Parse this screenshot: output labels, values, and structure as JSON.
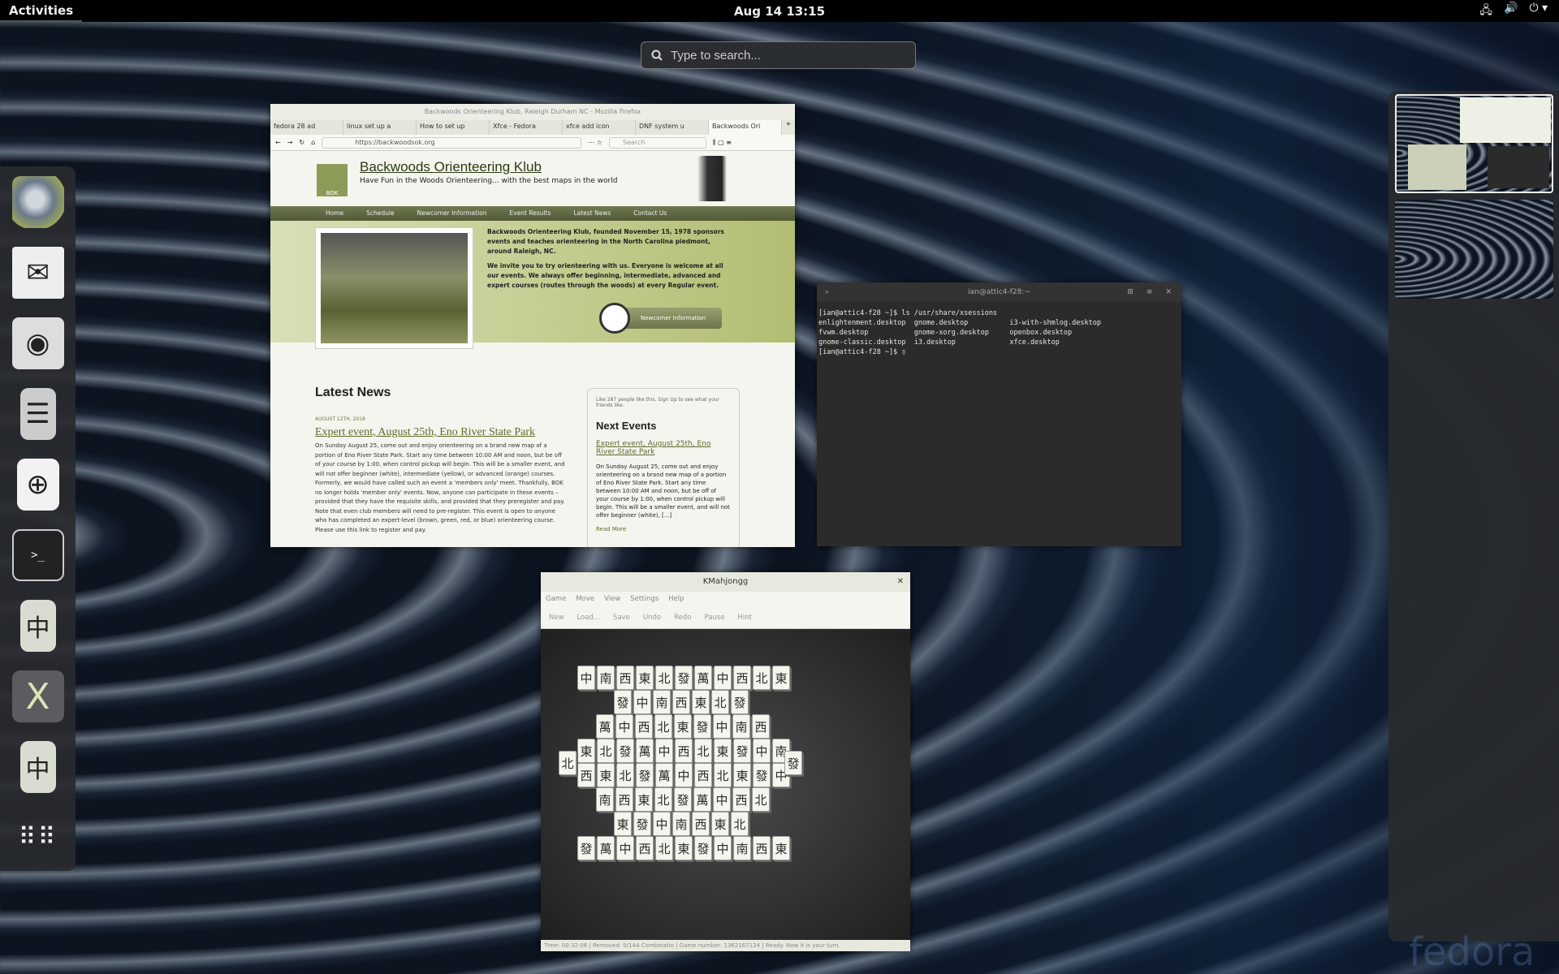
{
  "topbar": {
    "activities": "Activities",
    "clock": "Aug 14  13:15",
    "tray_icons": [
      "network-icon",
      "volume-icon",
      "power-icon"
    ],
    "tray_glyphs": [
      "🖧",
      "🔊",
      "⏻ ▾"
    ]
  },
  "search": {
    "placeholder": "Type to search..."
  },
  "dash": {
    "apps": [
      {
        "name": "firefox"
      },
      {
        "name": "evolution"
      },
      {
        "name": "rhythmbox"
      },
      {
        "name": "files"
      },
      {
        "name": "software"
      },
      {
        "name": "terminal"
      },
      {
        "name": "mahjongg"
      },
      {
        "name": "xfce"
      },
      {
        "name": "kmahjongg"
      },
      {
        "name": "show-applications"
      }
    ]
  },
  "firefox": {
    "title": "Backwoods Orienteering Klub, Raleigh Durham NC - Mozilla Firefox",
    "tabs": [
      "fedora 28 ad",
      "linux set up a",
      "How to set up",
      "Xfce - Fedora",
      "xfce add icon",
      "DNF system u",
      "Backwoods Ori"
    ],
    "url": "https://backwoodsok.org",
    "search_placeholder": "Search",
    "site": {
      "logo": "BOK",
      "title": "Backwoods Orienteering Klub",
      "tagline": "Have Fun in the Woods Orienteering... with the best maps in the world",
      "nav": [
        "Home",
        "Schedule",
        "Newcomer Information",
        "Event Results",
        "Latest News",
        "Contact Us"
      ],
      "intro1": "Backwoods Orienteering Klub, founded November 15, 1978 sponsors events and teaches orienteering in the North Carolina piedmont, around Raleigh, NC.",
      "intro2": "We invite you to try orienteering with us. Everyone is welcome at all our events. We always offer beginning, intermediate, advanced and expert courses (routes through the woods) at every Regular event.",
      "newcomer_btn": "Newcomer Information",
      "latest_news": "Latest News",
      "news_date": "AUGUST 12TH, 2018",
      "news_title": "Expert event, August 25th, Eno River State Park",
      "news_body": "On Sunday August 25, come out and enjoy orienteering on a brand new map of a portion of Eno River State Park. Start any time between 10:00 AM and noon, but be off of your course by 1:00, when control pickup will begin. This will be a smaller event, and will not offer beginner (white), intermediate (yellow), or advanced (orange) courses. Formerly, we would have called such an event a 'members only' meet. Thankfully, BOK no longer holds 'member only' events. Now, anyone can participate in these events – provided that they have the requisite skills, and provided that they preregister and pay. Note that even club members will need to pre-register. This event is open to anyone who has completed an expert-level (brown, green, red, or blue) orienteering course. Please use this link to register and pay.",
      "fb_text": "Like 287 people like this. Sign Up to see what your friends like.",
      "next_events": "Next Events",
      "event_link": "Expert event, August 25th, Eno River State Park",
      "event_body": "On Sunday August 25, come out and enjoy orienteering on a brand new map of a portion of Eno River State Park. Start any time between 10:00 AM and noon, but be off of your course by 1:00, when control pickup will begin. This will be a smaller event, and will not offer beginner (white), [...]",
      "read_more": "Read More"
    }
  },
  "terminal": {
    "title": "ian@attic4-f28:~",
    "lines": "[ian@attic4-f28 ~]$ ls /usr/share/xsessions\nenlightenment.desktop  gnome.desktop          i3-with-shmlog.desktop\nfvwm.desktop           gnome-xorg.desktop     openbox.desktop\ngnome-classic.desktop  i3.desktop             xfce.desktop\n[ian@attic4-f28 ~]$ ▯"
  },
  "kmahjongg": {
    "title": "KMahjongg",
    "menu": [
      "Game",
      "Move",
      "View",
      "Settings",
      "Help"
    ],
    "toolbar": [
      "New",
      "Load...",
      "Save",
      "Undo",
      "Redo",
      "Pause",
      "Hint"
    ],
    "status": "Time: 00:32:06 | Removed: 0/144  Combinatio  | Game number: 1362167124 | Ready. Now it is your turn.",
    "tiles": [
      "中",
      "南",
      "西",
      "東",
      "北",
      "發",
      "萬",
      "中",
      "西",
      "北",
      "東",
      "發"
    ]
  },
  "watermark": "fedora",
  "colors": {
    "topbar": "#000000",
    "dash": "#28292e",
    "accent_green": "#5c6a2a"
  }
}
